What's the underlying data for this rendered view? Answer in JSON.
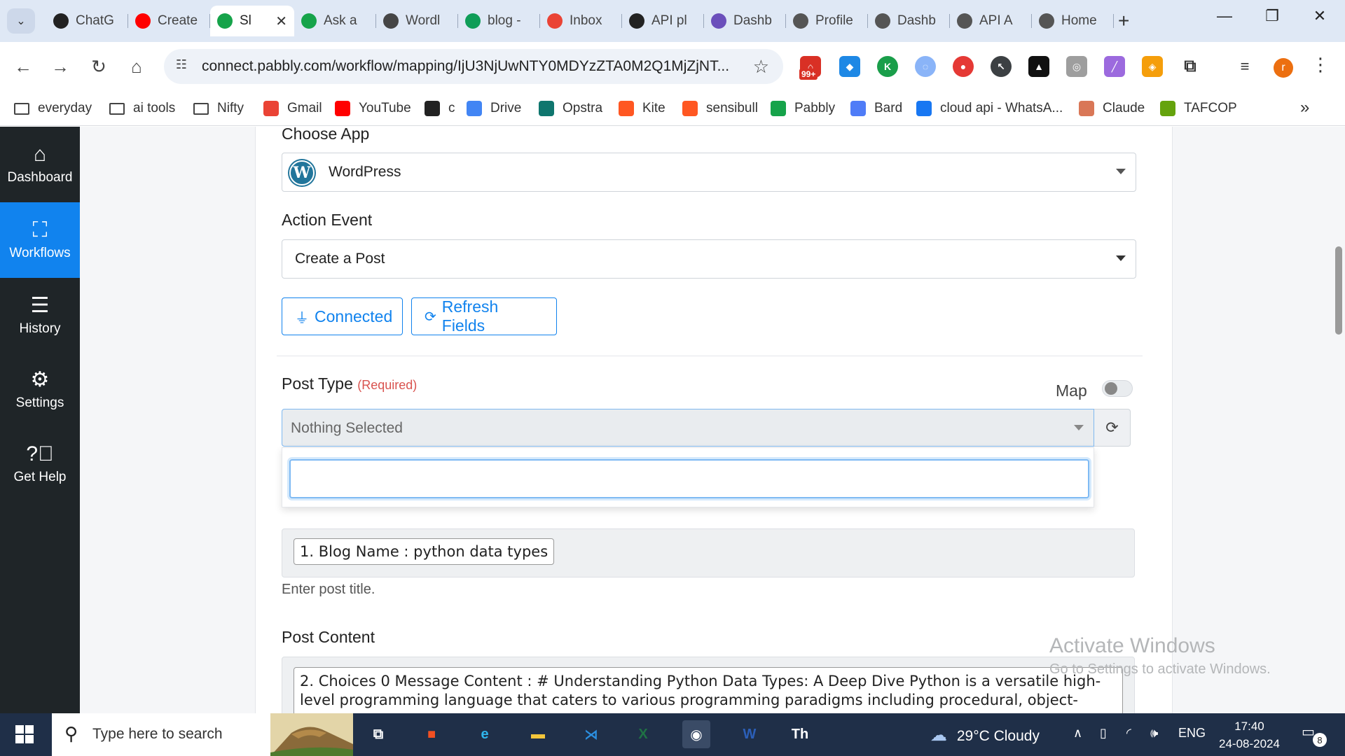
{
  "browser": {
    "tabs": [
      {
        "label": "ChatG",
        "icon": "openai-icon",
        "color": "#222222"
      },
      {
        "label": "Create",
        "icon": "youtube-icon",
        "color": "#ff0000"
      },
      {
        "label": "Sl",
        "icon": "pabbly-icon",
        "color": "#16a34a",
        "active": true
      },
      {
        "label": "Ask a",
        "icon": "pabbly-icon",
        "color": "#16a34a"
      },
      {
        "label": "Wordl",
        "icon": "wordpress-icon",
        "color": "#464646"
      },
      {
        "label": "blog -",
        "icon": "sheets-icon",
        "color": "#0f9d58"
      },
      {
        "label": "Inbox",
        "icon": "gmail-icon",
        "color": "#ea4335"
      },
      {
        "label": "API pl",
        "icon": "openai-icon",
        "color": "#222222"
      },
      {
        "label": "Dashb",
        "icon": "dashboard-icon",
        "color": "#6b4fbb"
      },
      {
        "label": "Profile",
        "icon": "globe-icon",
        "color": "#555555"
      },
      {
        "label": "Dashb",
        "icon": "globe-icon",
        "color": "#555555"
      },
      {
        "label": "API A",
        "icon": "globe-icon",
        "color": "#555555"
      },
      {
        "label": "Home",
        "icon": "globe-icon",
        "color": "#555555"
      }
    ],
    "url": "connect.pabbly.com/workflow/mapping/IjU3NjUwNTY0MDYzZTA0M2Q1MjZjNT...",
    "extension_badge": "99+",
    "profile_initial": "r",
    "bookmarks": [
      {
        "label": "everyday",
        "type": "folder"
      },
      {
        "label": "ai tools",
        "type": "folder"
      },
      {
        "label": "Nifty",
        "type": "folder"
      },
      {
        "label": "Gmail",
        "type": "link",
        "icon": "gmail-icon",
        "color": "#ea4335"
      },
      {
        "label": "YouTube",
        "type": "link",
        "icon": "youtube-icon",
        "color": "#ff0000"
      },
      {
        "label": "c",
        "type": "link",
        "icon": "openai-icon",
        "color": "#222222"
      },
      {
        "label": "Drive",
        "type": "link",
        "icon": "google-icon",
        "color": "#4285f4"
      },
      {
        "label": "Opstra",
        "type": "link",
        "icon": "opstra-icon",
        "color": "#0f766e"
      },
      {
        "label": "Kite",
        "type": "link",
        "icon": "kite-icon",
        "color": "#ff5722"
      },
      {
        "label": "sensibull",
        "type": "link",
        "icon": "sensibull-icon",
        "color": "#ff5722"
      },
      {
        "label": "Pabbly",
        "type": "link",
        "icon": "pabbly-icon",
        "color": "#16a34a"
      },
      {
        "label": "Bard",
        "type": "link",
        "icon": "bard-icon",
        "color": "#4f7cf7"
      },
      {
        "label": "cloud api - WhatsA...",
        "type": "link",
        "icon": "facebook-icon",
        "color": "#1877f2"
      },
      {
        "label": "Claude",
        "type": "link",
        "icon": "claude-icon",
        "color": "#d97757"
      },
      {
        "label": "TAFCOP",
        "type": "link",
        "icon": "tafcop-icon",
        "color": "#65a30d"
      }
    ]
  },
  "sidebar": {
    "items": [
      {
        "label": "Dashboard",
        "icon": "home-icon"
      },
      {
        "label": "Workflows",
        "icon": "workflows-icon",
        "active": true
      },
      {
        "label": "History",
        "icon": "history-icon"
      },
      {
        "label": "Settings",
        "icon": "gear-icon"
      },
      {
        "label": "Get Help",
        "icon": "help-icon"
      }
    ]
  },
  "form": {
    "choose_app_label": "Choose App",
    "app_value": "WordPress",
    "action_event_label": "Action Event",
    "action_event_value": "Create a Post",
    "connected_label": "Connected",
    "refresh_fields_label": "Refresh Fields",
    "post_type_label": "Post Type",
    "required_label": "(Required)",
    "map_label": "Map",
    "map_enabled": false,
    "post_type_value": "Nothing Selected",
    "post_type_search_value": "",
    "post_title_mapping": "1. Blog Name : python data types",
    "post_title_hint": "Enter post title.",
    "post_content_label": "Post Content",
    "post_content_mapping": "2. Choices 0 Message Content : # Understanding Python Data Types: A Deep Dive Python is a versatile high-level programming language that caters to various programming paradigms including procedural, object-"
  },
  "watermark": {
    "line1": "Activate Windows",
    "line2": "Go to Settings to activate Windows."
  },
  "taskbar": {
    "search_placeholder": "Type here to search",
    "weather": "29°C  Cloudy",
    "language": "ENG",
    "time": "17:40",
    "date": "24-08-2024",
    "notification_count": "8",
    "apps": [
      {
        "name": "task-view-icon",
        "glyph": "⧉"
      },
      {
        "name": "microsoft-store-icon",
        "glyph": "■"
      },
      {
        "name": "edge-icon",
        "glyph": "e"
      },
      {
        "name": "file-explorer-icon",
        "glyph": "▬"
      },
      {
        "name": "vscode-icon",
        "glyph": "⋊"
      },
      {
        "name": "excel-icon",
        "glyph": "X"
      },
      {
        "name": "chrome-icon",
        "glyph": "◉",
        "running": true
      },
      {
        "name": "word-icon",
        "glyph": "W"
      },
      {
        "name": "th-app-icon",
        "glyph": "Th"
      }
    ]
  }
}
